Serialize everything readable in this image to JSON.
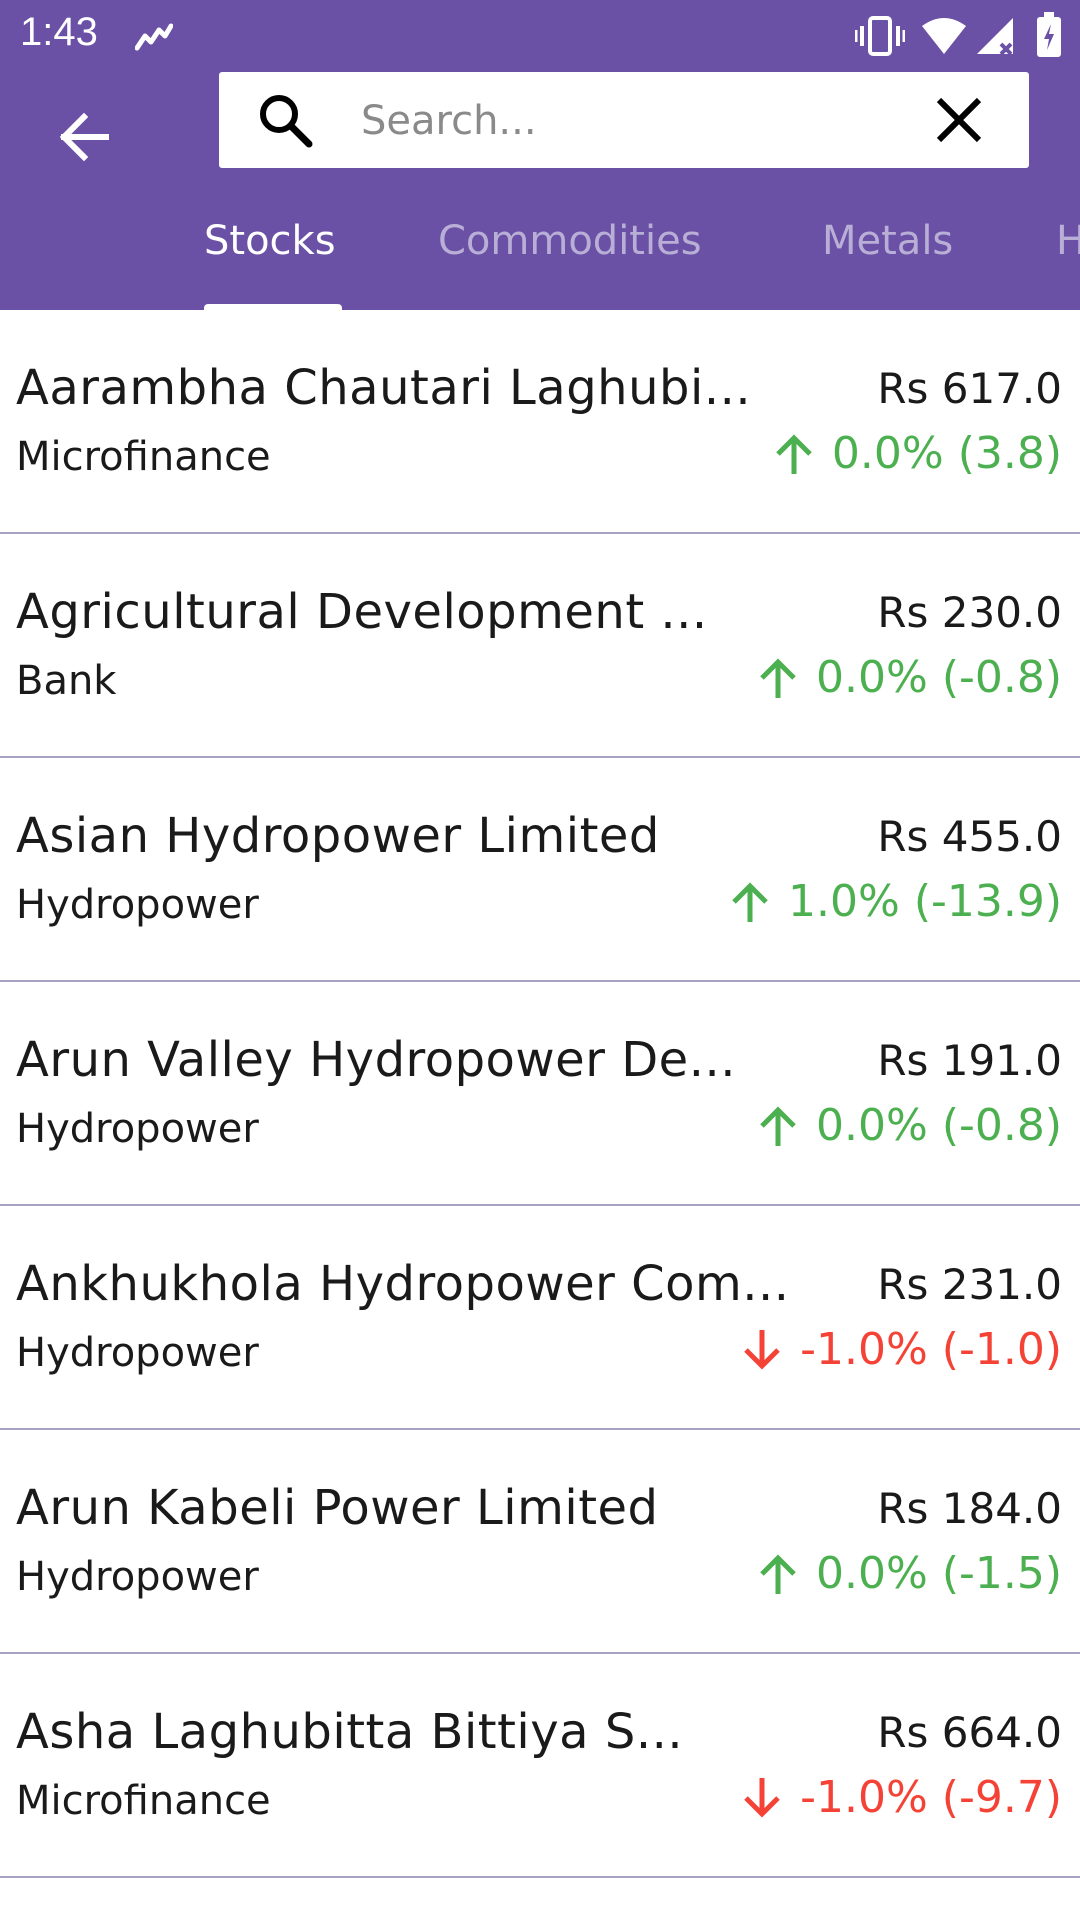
{
  "status_bar": {
    "time": "1:43",
    "icons": [
      "trend-icon",
      "vibrate-icon",
      "wifi-icon",
      "signal-icon",
      "battery-icon"
    ]
  },
  "app_bar": {
    "back_icon": "arrow-left-icon",
    "search": {
      "placeholder": "Search...",
      "value": ""
    },
    "clear_icon": "close-icon"
  },
  "tabs": [
    {
      "label": "Stocks",
      "active": true
    },
    {
      "label": "Commodities",
      "active": false
    },
    {
      "label": "Metals",
      "active": false
    },
    {
      "label": "H",
      "active": false
    }
  ],
  "colors": {
    "primary": "#6a51a6",
    "up": "#4caf50",
    "down": "#f44336",
    "divider": "#a7a2c4"
  },
  "stocks": [
    {
      "name": "Aarambha Chautari Laghubi...",
      "sector": "Microfinance",
      "price": "Rs 617.0",
      "direction": "up",
      "change": "0.0% (3.8)"
    },
    {
      "name": "Agricultural Development ...",
      "sector": "Bank",
      "price": "Rs 230.0",
      "direction": "up",
      "change": "0.0% (-0.8)"
    },
    {
      "name": "Asian Hydropower Limited",
      "sector": "Hydropower",
      "price": "Rs 455.0",
      "direction": "up",
      "change": "1.0% (-13.9)"
    },
    {
      "name": "Arun Valley Hydropower De...",
      "sector": "Hydropower",
      "price": "Rs 191.0",
      "direction": "up",
      "change": "0.0% (-0.8)"
    },
    {
      "name": "Ankhukhola Hydropower Com...",
      "sector": "Hydropower",
      "price": "Rs 231.0",
      "direction": "down",
      "change": "-1.0% (-1.0)"
    },
    {
      "name": "Arun Kabeli Power Limited",
      "sector": "Hydropower",
      "price": "Rs 184.0",
      "direction": "up",
      "change": "0.0% (-1.5)"
    },
    {
      "name": "Asha Laghubitta Bittiya S...",
      "sector": "Microfinance",
      "price": "Rs 664.0",
      "direction": "down",
      "change": "-1.0% (-9.7)"
    }
  ]
}
